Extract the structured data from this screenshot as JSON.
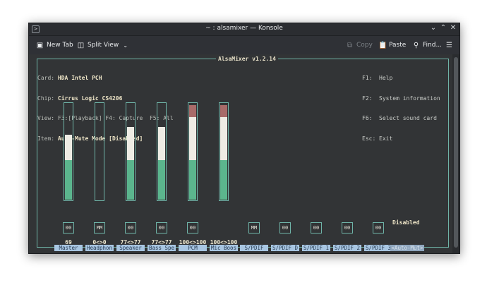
{
  "window": {
    "title": "~ : alsamixer — Konsole",
    "app_icon": "terminal-prompt-icon",
    "controls": [
      "chevron-down-icon",
      "minimize-icon",
      "close-icon"
    ]
  },
  "toolbar": {
    "new_tab": "New Tab",
    "split_view": "Split View",
    "copy": "Copy",
    "paste": "Paste",
    "find": "Find..."
  },
  "mixer": {
    "title": "AlsaMixer v1.2.14",
    "info": {
      "card_label": "Card:",
      "card_value": "HDA Intel PCH",
      "chip_label": "Chip:",
      "chip_value": "Cirrus Logic CS4206",
      "view_label": "View:",
      "view_value": "F3:[Playback] F4: Capture  F5: All",
      "item_label": "Item:",
      "item_value": "Auto-Mute Mode [Disabled]"
    },
    "keys": [
      {
        "key": "F1:",
        "action": "Help"
      },
      {
        "key": "F2:",
        "action": "System information"
      },
      {
        "key": "F6:",
        "action": "Select sound card"
      },
      {
        "key": "Esc:",
        "action": "Exit"
      }
    ],
    "channels": [
      {
        "name": "Master",
        "state": "00",
        "value": "69",
        "has_gauge": true,
        "level": 0.69,
        "peak": 0.69
      },
      {
        "name": "Headphon",
        "state": "MM",
        "value": "0<>0",
        "has_gauge": true,
        "level": 0,
        "peak": 0
      },
      {
        "name": "Speaker",
        "state": "00",
        "value": "77<>77",
        "has_gauge": true,
        "level": 0.77,
        "peak": 0.77
      },
      {
        "name": "Bass Spe",
        "state": "00",
        "value": "77<>77",
        "has_gauge": true,
        "level": 0.77,
        "peak": 0.77
      },
      {
        "name": "PCM",
        "state": "00",
        "value": "100<>100",
        "has_gauge": true,
        "level": 1.0,
        "peak": 1.0
      },
      {
        "name": "Mic Boos",
        "state": "",
        "value": "100<>100",
        "has_gauge": true,
        "level": 1.0,
        "peak": 1.0
      },
      {
        "name": "S/PDIF",
        "state": "MM",
        "value": "",
        "has_gauge": false
      },
      {
        "name": "S/PDIF D",
        "state": "00",
        "value": "",
        "has_gauge": false
      },
      {
        "name": "S/PDIF 1",
        "state": "00",
        "value": "",
        "has_gauge": false
      },
      {
        "name": "S/PDIF 2",
        "state": "00",
        "value": "",
        "has_gauge": false
      },
      {
        "name": "S/PDIF 3",
        "state": "00",
        "value": "",
        "has_gauge": false
      }
    ],
    "selected": {
      "label": "Auto-Mut",
      "value": "Disabled",
      "arrow_left": "<",
      "arrow_right": ">"
    },
    "colors": {
      "frame": "#6fb4a8",
      "gauge_green": "#5bb58d",
      "gauge_white": "#eeece4",
      "gauge_red": "#a86b69",
      "label_bg": "#a8c6e2"
    }
  }
}
